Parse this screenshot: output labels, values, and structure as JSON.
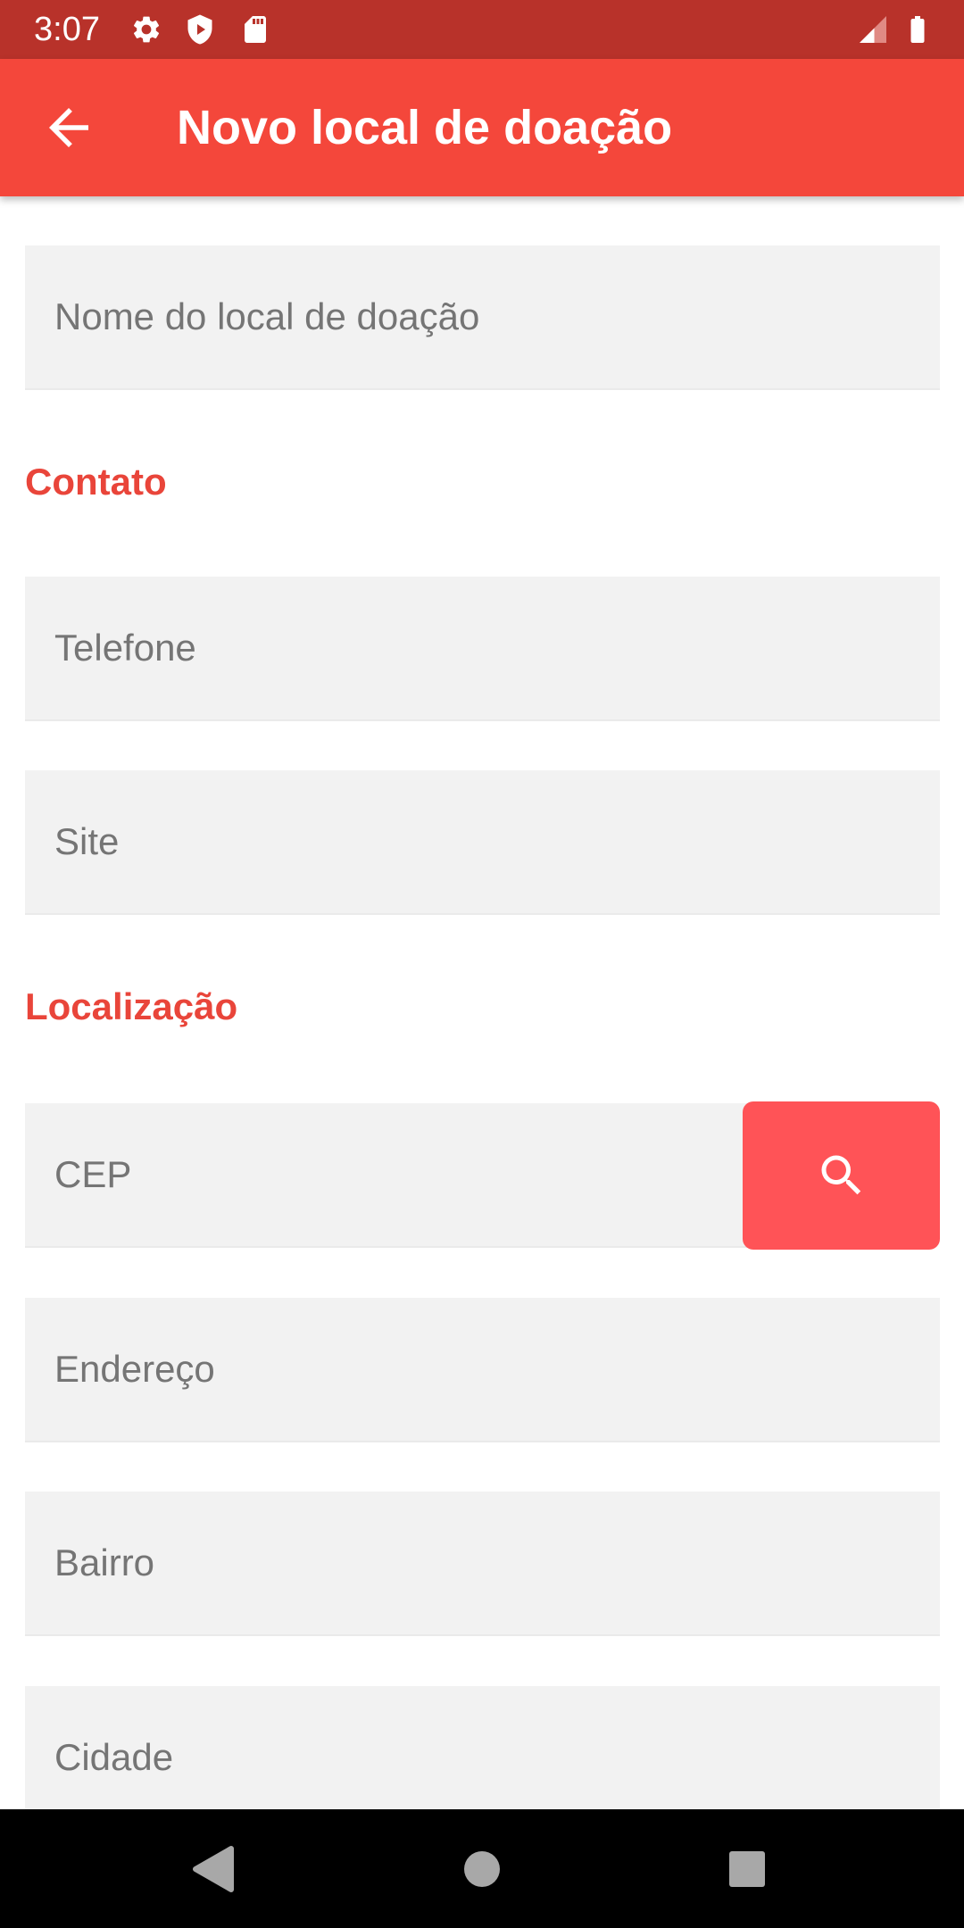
{
  "status_bar": {
    "time": "3:07",
    "icons": [
      "gear-icon",
      "shield-icon",
      "sd-card-icon",
      "cell-signal-icon",
      "battery-icon"
    ]
  },
  "app_bar": {
    "title": "Novo local de doação",
    "back_icon": "arrow-back-icon"
  },
  "form": {
    "name_placeholder": "Nome do local de doação",
    "contact_heading": "Contato",
    "phone_placeholder": "Telefone",
    "site_placeholder": "Site",
    "location_heading": "Localização",
    "cep_placeholder": "CEP",
    "search_icon": "search-icon",
    "address_placeholder": "Endereço",
    "district_placeholder": "Bairro",
    "city_placeholder": "Cidade"
  },
  "nav_bar": {
    "icons": [
      "back-triangle-icon",
      "home-circle-icon",
      "recents-square-icon"
    ]
  },
  "colors": {
    "status_bar": "#b8322a",
    "app_bar": "#f4473b",
    "accent_text": "#e9453a",
    "search_button": "#ff5357",
    "field_bg": "#f2f2f2"
  }
}
